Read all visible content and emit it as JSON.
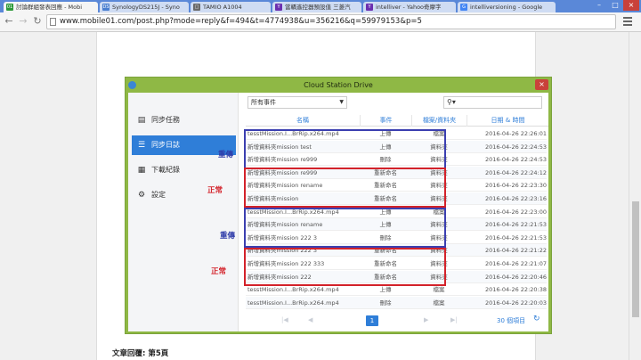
{
  "browser": {
    "tabs": [
      {
        "label": "討論群組發表回應 - Mobi",
        "fav_color": "#2e9a3a",
        "fav_text": "01"
      },
      {
        "label": "SynologyDS215J - Syno",
        "fav_color": "#4a7fd0",
        "fav_text": "DS"
      },
      {
        "label": "TAMIO A1004",
        "fav_color": "#6a6a6a",
        "fav_text": "□"
      },
      {
        "label": "當轎遙控器預設值 三菱汽",
        "fav_color": "#6b2fb0",
        "fav_text": "Y"
      },
      {
        "label": "intelliver - Yahoo奇摩字",
        "fav_color": "#6b2fb0",
        "fav_text": "Y"
      },
      {
        "label": "intelliversioning - Google",
        "fav_color": "#4285f4",
        "fav_text": "G"
      }
    ],
    "url": "www.mobile01.com/post.php?mode=reply&f=494&t=4774938&u=356216&q=59979153&p=5",
    "window_controls": [
      "–",
      "□",
      "×"
    ]
  },
  "page": {
    "reply_title": "文章回覆: 第5頁"
  },
  "cloud_station": {
    "title": "Cloud Station Drive",
    "close_label": "×",
    "sidebar": [
      {
        "label": "同步任務",
        "icon": "task-icon",
        "glyph": "▤"
      },
      {
        "label": "同步日誌",
        "icon": "log-icon",
        "glyph": "☰"
      },
      {
        "label": "下載紀錄",
        "icon": "download-log-icon",
        "glyph": "▦"
      },
      {
        "label": "設定",
        "icon": "gear-icon",
        "glyph": "⚙"
      }
    ],
    "filter": {
      "value": "所有事件",
      "caret": "▼"
    },
    "search": {
      "glyph": "⚲▾"
    },
    "columns": {
      "name": "名稱",
      "event": "事件",
      "type": "檔案/資料夾",
      "time": "日期 & 時間"
    },
    "rows": [
      {
        "name": "tesstMission.I...BrRip.x264.mp4",
        "event": "上傳",
        "type": "檔案",
        "time": "2016-04-26 22:26:01"
      },
      {
        "name": "新增資料夾mission test",
        "event": "上傳",
        "type": "資料夾",
        "time": "2016-04-26 22:24:53"
      },
      {
        "name": "新增資料夾mission re999",
        "event": "刪除",
        "type": "資料夾",
        "time": "2016-04-26 22:24:53"
      },
      {
        "name": "新增資料夾mission re999",
        "event": "重新命名",
        "type": "資料夾",
        "time": "2016-04-26 22:24:12"
      },
      {
        "name": "新增資料夾mission rename",
        "event": "重新命名",
        "type": "資料夾",
        "time": "2016-04-26 22:23:30"
      },
      {
        "name": "新增資料夾mission",
        "event": "重新命名",
        "type": "資料夾",
        "time": "2016-04-26 22:23:16"
      },
      {
        "name": "tesstMission.I...BrRip.x264.mp4",
        "event": "上傳",
        "type": "檔案",
        "time": "2016-04-26 22:23:00"
      },
      {
        "name": "新增資料夾mission rename",
        "event": "上傳",
        "type": "資料夾",
        "time": "2016-04-26 22:21:53"
      },
      {
        "name": "新增資料夾mission 222 3",
        "event": "刪除",
        "type": "資料夾",
        "time": "2016-04-26 22:21:53"
      },
      {
        "name": "新增資料夾mission 222 3",
        "event": "重新命名",
        "type": "資料夾",
        "time": "2016-04-26 22:21:22"
      },
      {
        "name": "新增資料夾mission 222 333",
        "event": "重新命名",
        "type": "資料夾",
        "time": "2016-04-26 22:21:07"
      },
      {
        "name": "新增資料夾mission 222",
        "event": "重新命名",
        "type": "資料夾",
        "time": "2016-04-26 22:20:46"
      },
      {
        "name": "tesstMission.I...BrRip.x264.mp4",
        "event": "上傳",
        "type": "檔案",
        "time": "2016-04-26 22:20:38"
      },
      {
        "name": "tesstMission.I...BrRip.x264.mp4",
        "event": "刪除",
        "type": "檔案",
        "time": "2016-04-26 22:20:03"
      }
    ],
    "pager": {
      "first": "|◀",
      "prev": "◀",
      "page": "1",
      "next": "▶",
      "last": "▶|",
      "count": "30 個項目",
      "refresh": "↻"
    }
  },
  "annotations": [
    {
      "label": "重傳",
      "color": "blue"
    },
    {
      "label": "正常",
      "color": "red"
    },
    {
      "label": "重傳",
      "color": "blue"
    },
    {
      "label": "正常",
      "color": "red"
    }
  ]
}
